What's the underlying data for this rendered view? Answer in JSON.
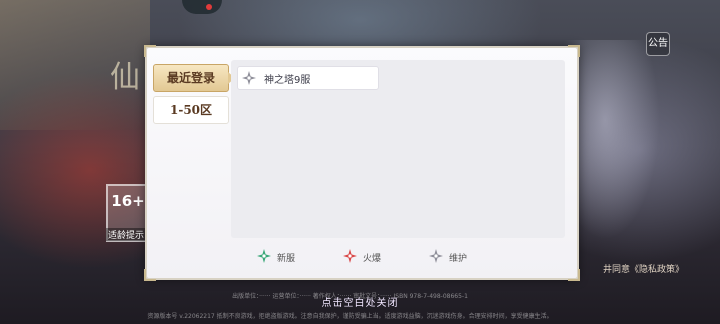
{
  "background": {
    "title_glyph": "仙",
    "age_rating": "16+",
    "age_label": "适龄提示",
    "top_right_label": "公告",
    "privacy_link": "井同意《隐私政策》",
    "footer_line1": "出版单位：······ 运营单位：······ 著作权人：······ 审批文号：······ ISBN 978-7-498-08665-1",
    "footer_line2": "资源版本号 v.22062217 抵制不良游戏，拒绝盗版游戏。注意自我保护，谨防受骗上当。适度游戏益脑，沉迷游戏伤身。合理安排时间，享受健康生活。"
  },
  "panel": {
    "tabs": [
      {
        "label": "最近登录",
        "active": true
      },
      {
        "label": "1-50区",
        "active": false
      }
    ],
    "servers": [
      {
        "name": "神之塔9服",
        "status": "maintenance"
      }
    ],
    "legend": [
      {
        "label": "新服",
        "color": "#3aa878",
        "icon": "new-server-icon"
      },
      {
        "label": "火爆",
        "color": "#d94848",
        "icon": "hot-server-icon"
      },
      {
        "label": "维护",
        "color": "#8f8f9a",
        "icon": "maintenance-icon"
      }
    ]
  },
  "close_hint": "点击空白处关闭"
}
